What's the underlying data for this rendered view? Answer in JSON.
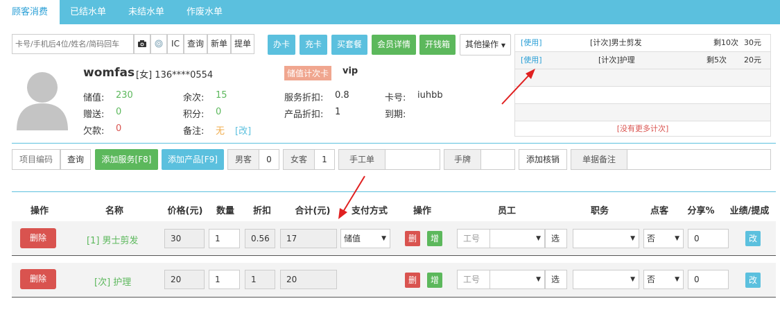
{
  "tabs": [
    "顾客消费",
    "已结水单",
    "未结水单",
    "作废水单"
  ],
  "search": {
    "placeholder": "卡号/手机后4位/姓名/简码回车",
    "ic_label": "IC",
    "query_label": "查询",
    "new_label": "新单",
    "fetch_label": "提单"
  },
  "actions": {
    "open_card": "办卡",
    "recharge": "充卡",
    "buy_package": "买套餐",
    "member_detail": "会员详情",
    "open_drawer": "开钱箱",
    "other_ops": "其他操作"
  },
  "packages": {
    "rows": [
      {
        "link": "[使用]",
        "name": "[计次]男士剪发",
        "remaining": "剩10次",
        "price": "30元"
      },
      {
        "link": "[使用]",
        "name": "[计次]护理",
        "remaining": "剩5次",
        "price": "20元"
      }
    ],
    "no_more": "[没有更多计次]"
  },
  "customer": {
    "name": "womfas",
    "gender": "[女]",
    "phone": "136****0554",
    "card_type": "储值计次卡",
    "level": "vip",
    "stored_label": "储值:",
    "stored_value": "230",
    "gift_label": "赠送:",
    "gift_value": "0",
    "debt_label": "欠款:",
    "debt_value": "0",
    "times_label": "余次:",
    "times_value": "15",
    "points_label": "积分:",
    "points_value": "0",
    "remark_label": "备注:",
    "remark_value": "无",
    "remark_edit": "[改]",
    "service_discount_label": "服务折扣:",
    "service_discount_value": "0.8",
    "product_discount_label": "产品折扣:",
    "product_discount_value": "1",
    "card_no_label": "卡号:",
    "card_no_value": "iuhbb",
    "expire_label": "到期:",
    "expire_value": ""
  },
  "order_bar": {
    "item_code": "项目编码",
    "query": "查询",
    "add_service": "添加服务[F8]",
    "add_product": "添加产品[F9]",
    "male_label": "男客",
    "male_value": "0",
    "female_label": "女客",
    "female_value": "1",
    "manual_label": "手工单",
    "tag_label": "手牌",
    "add_writeoff": "添加核销",
    "remark_label": "单据备注"
  },
  "table": {
    "headers": [
      "操作",
      "名称",
      "价格(元)",
      "数量",
      "折扣",
      "合计(元)",
      "支付方式",
      "操作",
      "员工",
      "职务",
      "点客",
      "分享%",
      "业绩/提成"
    ],
    "rows": [
      {
        "delete": "删除",
        "name": "[1] 男士剪发",
        "price": "30",
        "qty": "1",
        "discount": "0.56",
        "total": "17",
        "pay": "储值",
        "del_small": "删",
        "add_small": "增",
        "staff_placeholder": "工号",
        "pick": "选",
        "pointed": "否",
        "share": "0",
        "edit": "改"
      },
      {
        "delete": "删除",
        "name": "[次] 护理",
        "price": "20",
        "qty": "1",
        "discount": "1",
        "total": "20",
        "pay": "",
        "del_small": "删",
        "add_small": "增",
        "staff_placeholder": "工号",
        "pick": "选",
        "pointed": "否",
        "share": "0",
        "edit": "改"
      }
    ]
  },
  "colors": {
    "accent": "#5bc0de",
    "green": "#5cb85c",
    "red": "#d9534f",
    "arrow": "#e02020"
  }
}
